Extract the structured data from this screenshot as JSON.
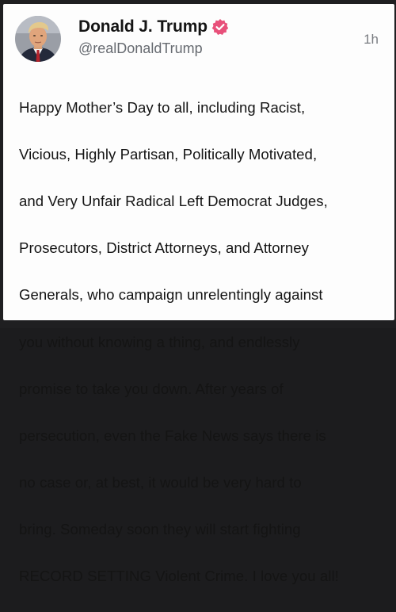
{
  "post": {
    "author": {
      "display_name": "Donald J. Trump",
      "handle": "@realDonaldTrump",
      "verified": true,
      "avatar_icon": "profile-photo-avatar",
      "verified_icon": "verified-badge-icon"
    },
    "timestamp": "1h",
    "text_lines": [
      "Happy Mother’s Day to all, including Racist,",
      "Vicious, Highly Partisan, Politically Motivated,",
      "and Very Unfair Radical Left Democrat Judges,",
      "Prosecutors, District Attorneys, and Attorney",
      "Generals, who campaign unrelentingly against",
      "you without knowing a thing, and endlessly",
      "promise to take you down. After years of",
      "persecution, even the Fake News says there is",
      "no case or, at best, it would be very hard to",
      "bring. Someday soon they will start fighting",
      "RECORD SETTING Violent Crime. I love you all!"
    ]
  },
  "colors": {
    "verified_badge": "#e8507a",
    "card_background": "#fdfdfd",
    "page_background": "#1f1f21",
    "text_primary": "#141414",
    "text_secondary": "#666a70"
  }
}
